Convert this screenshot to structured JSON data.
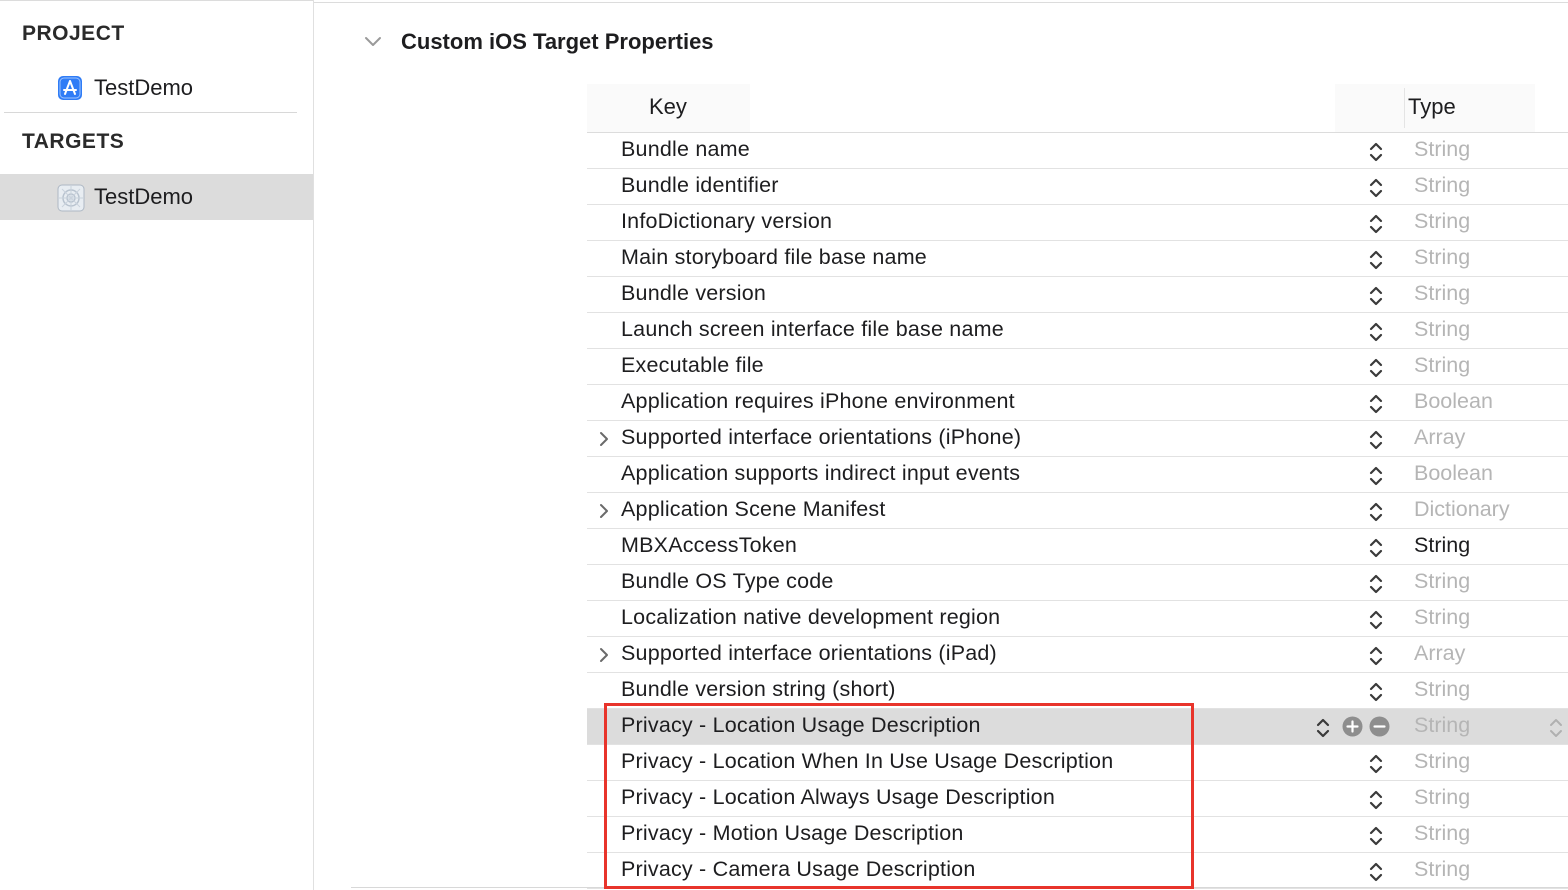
{
  "sidebar": {
    "project_header": "PROJECT",
    "project_item": {
      "label": "TestDemo",
      "icon": "app-store-icon"
    },
    "targets_header": "TARGETS",
    "target_item": {
      "label": "TestDemo",
      "icon": "target-icon"
    }
  },
  "section": {
    "title": "Custom iOS Target Properties",
    "expanded": true
  },
  "table": {
    "key_header": "Key",
    "type_header": "Type",
    "rows": [
      {
        "key": "Bundle name",
        "type": "String"
      },
      {
        "key": "Bundle identifier",
        "type": "String"
      },
      {
        "key": "InfoDictionary version",
        "type": "String"
      },
      {
        "key": "Main storyboard file base name",
        "type": "String"
      },
      {
        "key": "Bundle version",
        "type": "String"
      },
      {
        "key": "Launch screen interface file base name",
        "type": "String"
      },
      {
        "key": "Executable file",
        "type": "String"
      },
      {
        "key": "Application requires iPhone environment",
        "type": "Boolean"
      },
      {
        "key": "Supported interface orientations (iPhone)",
        "type": "Array"
      },
      {
        "key": "Application supports indirect input events",
        "type": "Boolean"
      },
      {
        "key": "Application Scene Manifest",
        "type": "Dictionary"
      },
      {
        "key": "MBXAccessToken",
        "type": "String"
      },
      {
        "key": "Bundle OS Type code",
        "type": "String"
      },
      {
        "key": "Localization native development region",
        "type": "String"
      },
      {
        "key": "Supported interface orientations (iPad)",
        "type": "Array"
      },
      {
        "key": "Bundle version string (short)",
        "type": "String"
      },
      {
        "key": "Privacy - Location Usage Description",
        "type": "String"
      },
      {
        "key": "Privacy - Location When In Use Usage Description",
        "type": "String"
      },
      {
        "key": "Privacy - Location Always Usage Description",
        "type": "String"
      },
      {
        "key": "Privacy - Motion Usage Description",
        "type": "String"
      },
      {
        "key": "Privacy - Camera Usage Description",
        "type": "String"
      }
    ],
    "expandable_rows": [
      8,
      10,
      14
    ],
    "selected_row": 16,
    "active_type_row": 11
  },
  "colors": {
    "highlight_border": "#e8342b",
    "selected_background": "#dcdcdc",
    "muted_type_text": "#b5b5b5"
  }
}
